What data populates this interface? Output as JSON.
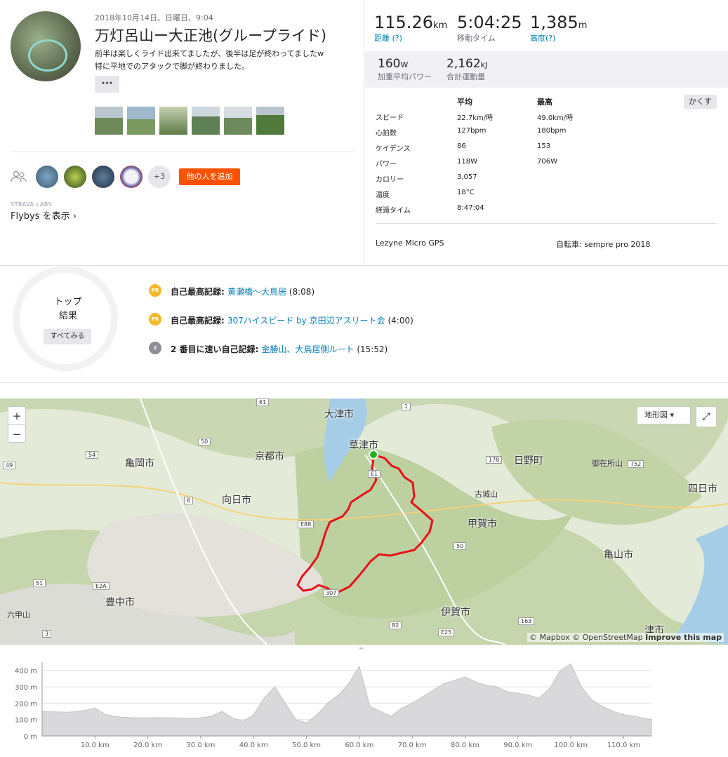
{
  "activity": {
    "date": "2018年10月14日、日曜日、9:04",
    "title": "万灯呂山ー大正池(グループライド)",
    "description_line1": "前半は楽しくライド出来てましたが、後半は足が終わってましたw",
    "description_line2": "特に平地でのアタックで脚が終わりました。",
    "more_label": "···"
  },
  "social": {
    "plus_count": "+3",
    "add_others_label": "他の人を追加",
    "labs_label": "STRAVA LABS",
    "flybys_label": "Flybys を表示 ›"
  },
  "stats": {
    "distance_value": "115.26",
    "distance_unit": "km",
    "distance_label": "距離 (?)",
    "moving_time_value": "5:04:25",
    "moving_time_label": "移動タイム",
    "elevation_value": "1,385",
    "elevation_unit": "m",
    "elevation_label": "高度(?)",
    "weighted_power_value": "160",
    "weighted_power_unit": "W",
    "weighted_power_label": "加重平均パワー",
    "work_value": "2,162",
    "work_unit": "kJ",
    "work_label": "合計運動量",
    "hide_label": "かくす",
    "col_avg": "平均",
    "col_max": "最高",
    "rows": [
      {
        "label": "スピード",
        "avg": "22.7km/時",
        "max": "49.0km/時"
      },
      {
        "label": "心拍数",
        "avg": "127bpm",
        "max": "180bpm"
      },
      {
        "label": "ケイデンス",
        "avg": "86",
        "max": "153"
      },
      {
        "label": "パワー",
        "avg": "118W",
        "max": "706W"
      },
      {
        "label": "カロリー",
        "avg": "3,057",
        "max": ""
      },
      {
        "label": "温度",
        "avg": "18°C",
        "max": ""
      },
      {
        "label": "経過タイム",
        "avg": "8:47:04",
        "max": ""
      }
    ],
    "device": "Lezyne Micro GPS",
    "bike": "自転車: sempre pro 2018"
  },
  "achievements": {
    "top_label_1": "トップ",
    "top_label_2": "結果",
    "see_all_label": "すべてみる",
    "items": [
      {
        "medal": "PR",
        "prefix": "自己最高記録:",
        "segment": "黄瀬橋〜大鳥居",
        "time": "(8:08)"
      },
      {
        "medal": "PR",
        "prefix": "自己最高記録:",
        "segment": "307ハイスピード by 京田辺アスリート会",
        "time": "(4:00)"
      },
      {
        "medal": "2",
        "prefix": "2 番目に速い自己記録:",
        "segment": "金勝山、大鳥居側ルート",
        "time": "(15:52)"
      }
    ]
  },
  "map": {
    "zoom_in": "+",
    "zoom_out": "−",
    "terrain_label": "地形図 ▾",
    "fullscreen_icon": "⤢",
    "attribution_1": "© Mapbox © OpenStreetMap",
    "attribution_2": "Improve this map",
    "cities": [
      {
        "name": "大津市"
      },
      {
        "name": "草津市"
      },
      {
        "name": "京都市"
      },
      {
        "name": "亀岡市"
      },
      {
        "name": "向日市"
      },
      {
        "name": "甲賀市"
      },
      {
        "name": "日野町"
      },
      {
        "name": "四日市"
      },
      {
        "name": "亀山市"
      },
      {
        "name": "豊中市"
      },
      {
        "name": "伊賀市"
      },
      {
        "name": "津市"
      }
    ],
    "small_places": [
      "古城山",
      "御在所山",
      "六甲山"
    ],
    "roads": [
      "61",
      "50",
      "49",
      "54",
      "6",
      "E88",
      "E1",
      "178",
      "752",
      "50",
      "51",
      "E2A",
      "307",
      "82",
      "3",
      "163",
      "E25",
      "1"
    ],
    "route_color": "#e8101a",
    "start_color": "#1fb423"
  },
  "elevation": {
    "y_labels": [
      "400 m",
      "300 m",
      "200 m",
      "100 m",
      "0 m"
    ],
    "x_labels": [
      "10.0 km",
      "20.0 km",
      "30.0 km",
      "40.0 km",
      "50.0 km",
      "60.0 km",
      "70.0 km",
      "80.0 km",
      "90.0 km",
      "100.0 km",
      "110.0 km"
    ]
  },
  "chart_data": {
    "type": "area",
    "xlabel": "",
    "ylabel": "",
    "ylim": [
      0,
      450
    ],
    "xlim": [
      0,
      115.26
    ],
    "x": [
      0,
      2,
      5,
      8,
      10,
      12,
      15,
      18,
      20,
      22,
      25,
      28,
      30,
      32,
      34,
      36,
      38,
      40,
      42,
      44,
      46,
      48,
      50,
      52,
      54,
      56,
      58,
      60,
      62,
      64,
      66,
      68,
      70,
      72,
      74,
      76,
      78,
      80,
      82,
      84,
      86,
      88,
      90,
      92,
      94,
      96,
      98,
      100,
      102,
      104,
      106,
      108,
      110,
      112,
      115.26
    ],
    "y": [
      150,
      148,
      145,
      155,
      170,
      130,
      115,
      110,
      110,
      112,
      110,
      108,
      110,
      120,
      150,
      110,
      90,
      130,
      230,
      300,
      200,
      100,
      80,
      130,
      200,
      250,
      320,
      425,
      180,
      150,
      120,
      170,
      200,
      240,
      280,
      320,
      340,
      360,
      330,
      310,
      300,
      270,
      260,
      250,
      230,
      290,
      400,
      440,
      300,
      220,
      180,
      150,
      130,
      120,
      100
    ]
  }
}
